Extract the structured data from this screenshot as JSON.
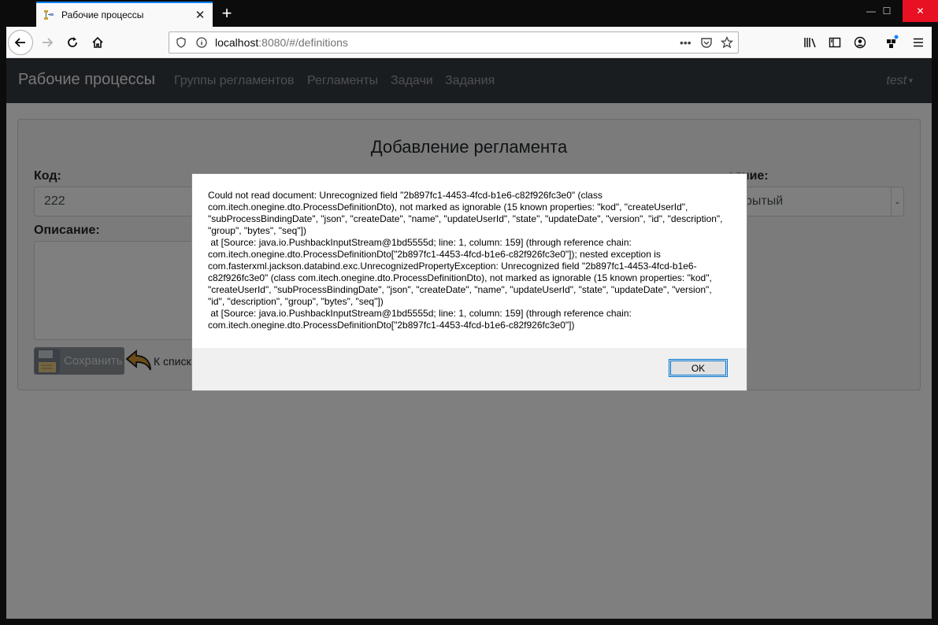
{
  "browser": {
    "tab_title": "Рабочие процессы",
    "url_host": "localhost",
    "url_rest": ":8080/#/definitions",
    "new_tab_label": "+"
  },
  "app": {
    "brand": "Рабочие процессы",
    "nav": [
      "Группы регламентов",
      "Регламенты",
      "Задачи",
      "Задания"
    ],
    "user": "test"
  },
  "form": {
    "title": "Добавление регламента",
    "code_label": "Код:",
    "code_value": "222",
    "state_label_fragment": "ояние:",
    "state_value_fragment": "рытый",
    "description_label": "Описание:",
    "save_label": "Сохранить",
    "back_label": "К списку"
  },
  "dialog": {
    "message": "Could not read document: Unrecognized field \"2b897fc1-4453-4fcd-b1e6-c82f926fc3e0\" (class\ncom.itech.onegine.dto.ProcessDefinitionDto), not marked as ignorable (15 known properties: \"kod\", \"createUserId\",\n\"subProcessBindingDate\", \"json\", \"createDate\", \"name\", \"updateUserId\", \"state\", \"updateDate\", \"version\", \"id\", \"description\",\n\"group\", \"bytes\", \"seq\"])\n at [Source: java.io.PushbackInputStream@1bd5555d; line: 1, column: 159] (through reference chain:\ncom.itech.onegine.dto.ProcessDefinitionDto[\"2b897fc1-4453-4fcd-b1e6-c82f926fc3e0\"]); nested exception is\ncom.fasterxml.jackson.databind.exc.UnrecognizedPropertyException: Unrecognized field \"2b897fc1-4453-4fcd-b1e6-\nc82f926fc3e0\" (class com.itech.onegine.dto.ProcessDefinitionDto), not marked as ignorable (15 known properties: \"kod\",\n\"createUserId\", \"subProcessBindingDate\", \"json\", \"createDate\", \"name\", \"updateUserId\", \"state\", \"updateDate\", \"version\",\n\"id\", \"description\", \"group\", \"bytes\", \"seq\"])\n at [Source: java.io.PushbackInputStream@1bd5555d; line: 1, column: 159] (through reference chain:\ncom.itech.onegine.dto.ProcessDefinitionDto[\"2b897fc1-4453-4fcd-b1e6-c82f926fc3e0\"])",
    "ok_label": "OK"
  }
}
